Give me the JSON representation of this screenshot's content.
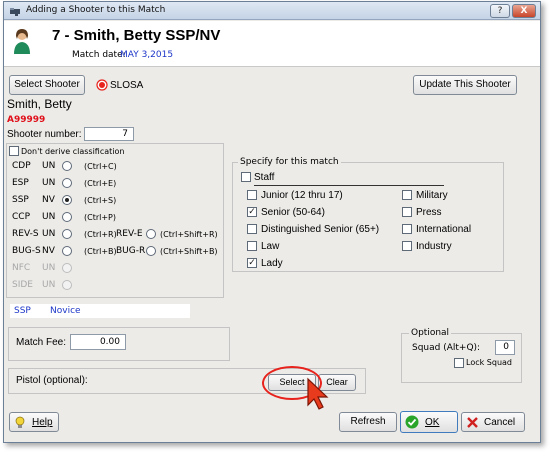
{
  "window": {
    "title": "Adding a Shooter to this Match",
    "help_btn": "?",
    "close_btn": "X"
  },
  "header": {
    "title": "7 - Smith, Betty   SSP/NV",
    "match_date_label": "Match date:",
    "match_date_value": "MAY  3,2015"
  },
  "top_buttons": {
    "select_shooter": "Select Shooter",
    "slosa": "SLOSA",
    "update_shooter": "Update This Shooter"
  },
  "shooter": {
    "name": "Smith, Betty",
    "id": "A99999",
    "number_label": "Shooter number:",
    "number_value": "7",
    "dont_derive": "Don't derive classification"
  },
  "divisions": [
    {
      "code": "CDP",
      "class": "UN",
      "shortcut": "(Ctrl+C)",
      "selected": false,
      "disabled": false
    },
    {
      "code": "ESP",
      "class": "UN",
      "shortcut": "(Ctrl+E)",
      "selected": false,
      "disabled": false
    },
    {
      "code": "SSP",
      "class": "NV",
      "shortcut": "(Ctrl+S)",
      "selected": true,
      "disabled": false
    },
    {
      "code": "CCP",
      "class": "UN",
      "shortcut": "(Ctrl+P)",
      "selected": false,
      "disabled": false
    },
    {
      "code": "REV-S",
      "class": "UN",
      "shortcut": "(Ctrl+R)",
      "selected": false,
      "disabled": false
    },
    {
      "code": "BUG-S",
      "class": "NV",
      "shortcut": "(Ctrl+B)",
      "selected": false,
      "disabled": false
    },
    {
      "code": "NFC",
      "class": "UN",
      "shortcut": "",
      "selected": false,
      "disabled": true
    },
    {
      "code": "SIDE",
      "class": "UN",
      "shortcut": "",
      "selected": false,
      "disabled": true
    }
  ],
  "divisions_right": [
    {
      "code": "REV-E",
      "shortcut": "(Ctrl+Shift+R)"
    },
    {
      "code": "BUG-R",
      "shortcut": "(Ctrl+Shift+B)"
    }
  ],
  "summary": {
    "division": "SSP",
    "classification": "Novice"
  },
  "specify": {
    "legend": "Specify for this match",
    "staff": "Staff",
    "left": [
      {
        "label": "Junior (12 thru 17)",
        "checked": false
      },
      {
        "label": "Senior (50-64)",
        "checked": true
      },
      {
        "label": "Distinguished Senior (65+)",
        "checked": false
      },
      {
        "label": "Law",
        "checked": false
      },
      {
        "label": "Lady",
        "checked": true
      }
    ],
    "right": [
      {
        "label": "Military",
        "checked": false
      },
      {
        "label": "Press",
        "checked": false
      },
      {
        "label": "International",
        "checked": false
      },
      {
        "label": "Industry",
        "checked": false
      }
    ]
  },
  "fee": {
    "label": "Match Fee:",
    "value": "0.00"
  },
  "optional": {
    "legend": "Optional",
    "squad_label": "Squad (Alt+Q):",
    "squad_value": "0",
    "lock_squad": "Lock Squad"
  },
  "pistol": {
    "label": "Pistol (optional):",
    "select": "Select",
    "clear": "Clear"
  },
  "bottom": {
    "help": "Help",
    "refresh": "Refresh",
    "ok": "OK",
    "cancel": "Cancel"
  },
  "colors": {
    "accent_blue": "#1c36c8",
    "id_red": "#e0101a",
    "highlight_red": "#e8221c",
    "ok_green": "#2aa52a",
    "cancel_red": "#d02020"
  }
}
